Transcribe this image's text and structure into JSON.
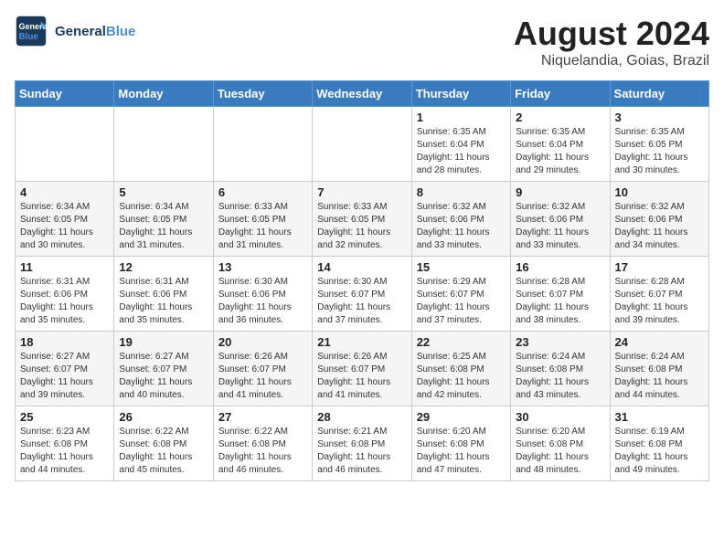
{
  "header": {
    "logo_line1": "General",
    "logo_line2": "Blue",
    "month": "August 2024",
    "location": "Niquelandia, Goias, Brazil"
  },
  "weekdays": [
    "Sunday",
    "Monday",
    "Tuesday",
    "Wednesday",
    "Thursday",
    "Friday",
    "Saturday"
  ],
  "weeks": [
    [
      {
        "day": "",
        "sunrise": "",
        "sunset": "",
        "daylight": ""
      },
      {
        "day": "",
        "sunrise": "",
        "sunset": "",
        "daylight": ""
      },
      {
        "day": "",
        "sunrise": "",
        "sunset": "",
        "daylight": ""
      },
      {
        "day": "",
        "sunrise": "",
        "sunset": "",
        "daylight": ""
      },
      {
        "day": "1",
        "sunrise": "Sunrise: 6:35 AM",
        "sunset": "Sunset: 6:04 PM",
        "daylight": "Daylight: 11 hours and 28 minutes."
      },
      {
        "day": "2",
        "sunrise": "Sunrise: 6:35 AM",
        "sunset": "Sunset: 6:04 PM",
        "daylight": "Daylight: 11 hours and 29 minutes."
      },
      {
        "day": "3",
        "sunrise": "Sunrise: 6:35 AM",
        "sunset": "Sunset: 6:05 PM",
        "daylight": "Daylight: 11 hours and 30 minutes."
      }
    ],
    [
      {
        "day": "4",
        "sunrise": "Sunrise: 6:34 AM",
        "sunset": "Sunset: 6:05 PM",
        "daylight": "Daylight: 11 hours and 30 minutes."
      },
      {
        "day": "5",
        "sunrise": "Sunrise: 6:34 AM",
        "sunset": "Sunset: 6:05 PM",
        "daylight": "Daylight: 11 hours and 31 minutes."
      },
      {
        "day": "6",
        "sunrise": "Sunrise: 6:33 AM",
        "sunset": "Sunset: 6:05 PM",
        "daylight": "Daylight: 11 hours and 31 minutes."
      },
      {
        "day": "7",
        "sunrise": "Sunrise: 6:33 AM",
        "sunset": "Sunset: 6:05 PM",
        "daylight": "Daylight: 11 hours and 32 minutes."
      },
      {
        "day": "8",
        "sunrise": "Sunrise: 6:32 AM",
        "sunset": "Sunset: 6:06 PM",
        "daylight": "Daylight: 11 hours and 33 minutes."
      },
      {
        "day": "9",
        "sunrise": "Sunrise: 6:32 AM",
        "sunset": "Sunset: 6:06 PM",
        "daylight": "Daylight: 11 hours and 33 minutes."
      },
      {
        "day": "10",
        "sunrise": "Sunrise: 6:32 AM",
        "sunset": "Sunset: 6:06 PM",
        "daylight": "Daylight: 11 hours and 34 minutes."
      }
    ],
    [
      {
        "day": "11",
        "sunrise": "Sunrise: 6:31 AM",
        "sunset": "Sunset: 6:06 PM",
        "daylight": "Daylight: 11 hours and 35 minutes."
      },
      {
        "day": "12",
        "sunrise": "Sunrise: 6:31 AM",
        "sunset": "Sunset: 6:06 PM",
        "daylight": "Daylight: 11 hours and 35 minutes."
      },
      {
        "day": "13",
        "sunrise": "Sunrise: 6:30 AM",
        "sunset": "Sunset: 6:06 PM",
        "daylight": "Daylight: 11 hours and 36 minutes."
      },
      {
        "day": "14",
        "sunrise": "Sunrise: 6:30 AM",
        "sunset": "Sunset: 6:07 PM",
        "daylight": "Daylight: 11 hours and 37 minutes."
      },
      {
        "day": "15",
        "sunrise": "Sunrise: 6:29 AM",
        "sunset": "Sunset: 6:07 PM",
        "daylight": "Daylight: 11 hours and 37 minutes."
      },
      {
        "day": "16",
        "sunrise": "Sunrise: 6:28 AM",
        "sunset": "Sunset: 6:07 PM",
        "daylight": "Daylight: 11 hours and 38 minutes."
      },
      {
        "day": "17",
        "sunrise": "Sunrise: 6:28 AM",
        "sunset": "Sunset: 6:07 PM",
        "daylight": "Daylight: 11 hours and 39 minutes."
      }
    ],
    [
      {
        "day": "18",
        "sunrise": "Sunrise: 6:27 AM",
        "sunset": "Sunset: 6:07 PM",
        "daylight": "Daylight: 11 hours and 39 minutes."
      },
      {
        "day": "19",
        "sunrise": "Sunrise: 6:27 AM",
        "sunset": "Sunset: 6:07 PM",
        "daylight": "Daylight: 11 hours and 40 minutes."
      },
      {
        "day": "20",
        "sunrise": "Sunrise: 6:26 AM",
        "sunset": "Sunset: 6:07 PM",
        "daylight": "Daylight: 11 hours and 41 minutes."
      },
      {
        "day": "21",
        "sunrise": "Sunrise: 6:26 AM",
        "sunset": "Sunset: 6:07 PM",
        "daylight": "Daylight: 11 hours and 41 minutes."
      },
      {
        "day": "22",
        "sunrise": "Sunrise: 6:25 AM",
        "sunset": "Sunset: 6:08 PM",
        "daylight": "Daylight: 11 hours and 42 minutes."
      },
      {
        "day": "23",
        "sunrise": "Sunrise: 6:24 AM",
        "sunset": "Sunset: 6:08 PM",
        "daylight": "Daylight: 11 hours and 43 minutes."
      },
      {
        "day": "24",
        "sunrise": "Sunrise: 6:24 AM",
        "sunset": "Sunset: 6:08 PM",
        "daylight": "Daylight: 11 hours and 44 minutes."
      }
    ],
    [
      {
        "day": "25",
        "sunrise": "Sunrise: 6:23 AM",
        "sunset": "Sunset: 6:08 PM",
        "daylight": "Daylight: 11 hours and 44 minutes."
      },
      {
        "day": "26",
        "sunrise": "Sunrise: 6:22 AM",
        "sunset": "Sunset: 6:08 PM",
        "daylight": "Daylight: 11 hours and 45 minutes."
      },
      {
        "day": "27",
        "sunrise": "Sunrise: 6:22 AM",
        "sunset": "Sunset: 6:08 PM",
        "daylight": "Daylight: 11 hours and 46 minutes."
      },
      {
        "day": "28",
        "sunrise": "Sunrise: 6:21 AM",
        "sunset": "Sunset: 6:08 PM",
        "daylight": "Daylight: 11 hours and 46 minutes."
      },
      {
        "day": "29",
        "sunrise": "Sunrise: 6:20 AM",
        "sunset": "Sunset: 6:08 PM",
        "daylight": "Daylight: 11 hours and 47 minutes."
      },
      {
        "day": "30",
        "sunrise": "Sunrise: 6:20 AM",
        "sunset": "Sunset: 6:08 PM",
        "daylight": "Daylight: 11 hours and 48 minutes."
      },
      {
        "day": "31",
        "sunrise": "Sunrise: 6:19 AM",
        "sunset": "Sunset: 6:08 PM",
        "daylight": "Daylight: 11 hours and 49 minutes."
      }
    ]
  ]
}
